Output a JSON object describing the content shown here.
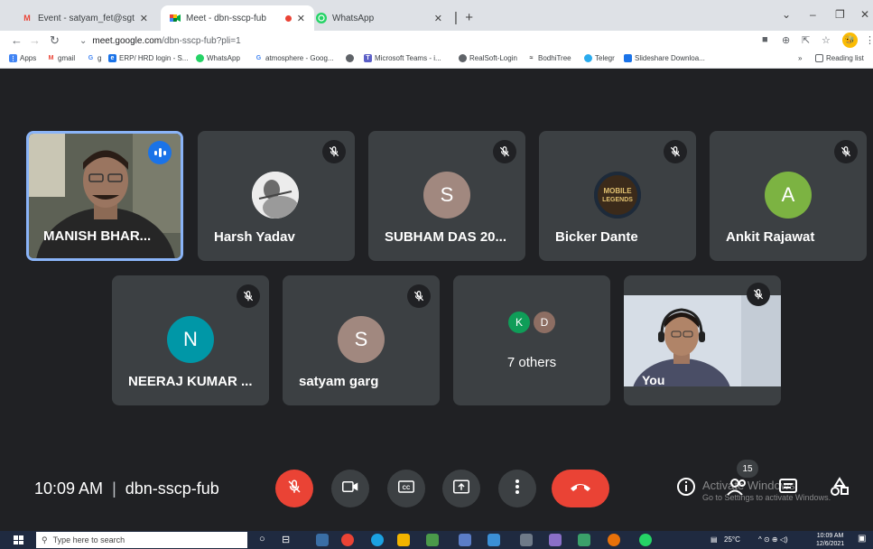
{
  "browser": {
    "tabs": [
      {
        "title": "Event - satyam_fet@sgtuniversity",
        "favicon": "gmail-icon",
        "closable": true
      },
      {
        "title": "Meet - dbn-sscp-fub",
        "favicon": "meet-icon",
        "closable": true,
        "recording": true
      },
      {
        "title": "WhatsApp",
        "favicon": "whatsapp-icon",
        "closable": true
      }
    ],
    "url_host": "meet.google.com",
    "url_path": "/dbn-sscp-fub?pli=1",
    "bookmarks": [
      {
        "label": "Apps",
        "icon": "apps-grid-icon"
      },
      {
        "label": "gmail",
        "icon": "gmail-icon"
      },
      {
        "label": "g",
        "icon": "google-icon"
      },
      {
        "label": "ERP/ HRD login - S...",
        "icon": "erp-icon"
      },
      {
        "label": "WhatsApp",
        "icon": "whatsapp-icon"
      },
      {
        "label": "atmosphere - Goog...",
        "icon": "google-icon"
      },
      {
        "label": "",
        "icon": "globe-icon"
      },
      {
        "label": "Microsoft Teams - i...",
        "icon": "teams-icon"
      },
      {
        "label": "RealSoft-Login",
        "icon": "globe-icon"
      },
      {
        "label": "BodhiTree",
        "icon": "bodhitree-icon"
      },
      {
        "label": "Telegr",
        "icon": "telegram-icon"
      },
      {
        "label": "Slideshare Downloa...",
        "icon": "bookmark-icon"
      }
    ],
    "reading_list": "Reading list",
    "overflow": "»"
  },
  "meet": {
    "participants": [
      {
        "name": "MANISH BHAR...",
        "type": "video",
        "speaking": true
      },
      {
        "name": "Harsh Yadav",
        "type": "photo",
        "muted": true
      },
      {
        "name": "SUBHAM DAS 20...",
        "type": "initial",
        "initial": "S",
        "color": "#a1887f",
        "muted": true
      },
      {
        "name": "Bicker Dante",
        "type": "photo",
        "muted": true
      },
      {
        "name": "Ankit Rajawat",
        "type": "initial",
        "initial": "A",
        "color": "#7cb342",
        "muted": true
      },
      {
        "name": "NEERAJ KUMAR ...",
        "type": "initial",
        "initial": "N",
        "color": "#0097a7",
        "muted": true
      },
      {
        "name": "satyam garg",
        "type": "initial",
        "initial": "S",
        "color": "#a1887f",
        "muted": true
      },
      {
        "name": "7 others",
        "type": "group",
        "initials": [
          "K",
          "D"
        ],
        "colors": [
          "#0f9d58",
          "#8d6e63"
        ]
      },
      {
        "name": "You",
        "type": "video",
        "muted": true
      }
    ],
    "photo_labels": {
      "bicker": "MOBILE LEGENDS"
    },
    "time": "10:09 AM",
    "meeting_code": "dbn-sscp-fub",
    "participant_count": "15",
    "controls": [
      "mic-off-icon",
      "camera-icon",
      "captions-icon",
      "present-icon",
      "more-vert-icon",
      "end-call-icon"
    ],
    "right_controls": [
      "info-icon",
      "people-icon",
      "chat-icon",
      "activities-icon"
    ]
  },
  "windows": {
    "watermark_title": "Activate Windows",
    "watermark_sub": "Go to Settings to activate Windows.",
    "search_placeholder": "Type here to search",
    "temperature": "25°C",
    "clock_time": "10:09 AM",
    "clock_date": "12/6/2021"
  },
  "colors": {
    "accent": "#8ab4f8",
    "danger": "#ea4335",
    "stage": "#202124",
    "tile": "#3c4043"
  }
}
